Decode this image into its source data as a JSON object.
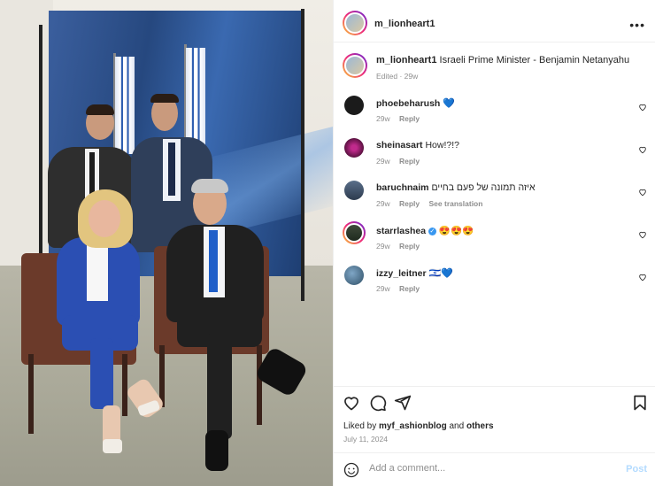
{
  "post": {
    "author": "m_lionheart1",
    "caption_text": "Israeli Prime Minister - Benjamin Netanyahu",
    "caption_meta": "Edited · 29w",
    "more_icon": "more-horizontal-icon"
  },
  "comments": [
    {
      "user": "phoebeharush",
      "text": "",
      "suffix": "💙",
      "age": "29w",
      "reply": "Reply",
      "see_translation": ""
    },
    {
      "user": "sheinasart",
      "text": "How!?!?",
      "suffix": "",
      "age": "29w",
      "reply": "Reply",
      "see_translation": ""
    },
    {
      "user": "baruchnaim",
      "text": "איזה תמונה של פעם בחיים",
      "suffix": "",
      "age": "29w",
      "reply": "Reply",
      "see_translation": "See translation"
    },
    {
      "user": "starrlashea",
      "text": "",
      "suffix": "😍😍😍",
      "age": "29w",
      "reply": "Reply",
      "see_translation": "",
      "verified": true
    },
    {
      "user": "izzy_leitner",
      "text": "",
      "suffix": "🇮🇱💙",
      "age": "29w",
      "reply": "Reply",
      "see_translation": ""
    }
  ],
  "likes": {
    "prefix": "Liked by",
    "user": "myf_ashionblog",
    "and": "and",
    "others": "others"
  },
  "date": "July 11, 2024",
  "add_comment": {
    "placeholder": "Add a comment...",
    "post_label": "Post"
  },
  "colors": {
    "accent": "#3897f0",
    "muted": "#8e8e8e",
    "text": "#262626"
  }
}
